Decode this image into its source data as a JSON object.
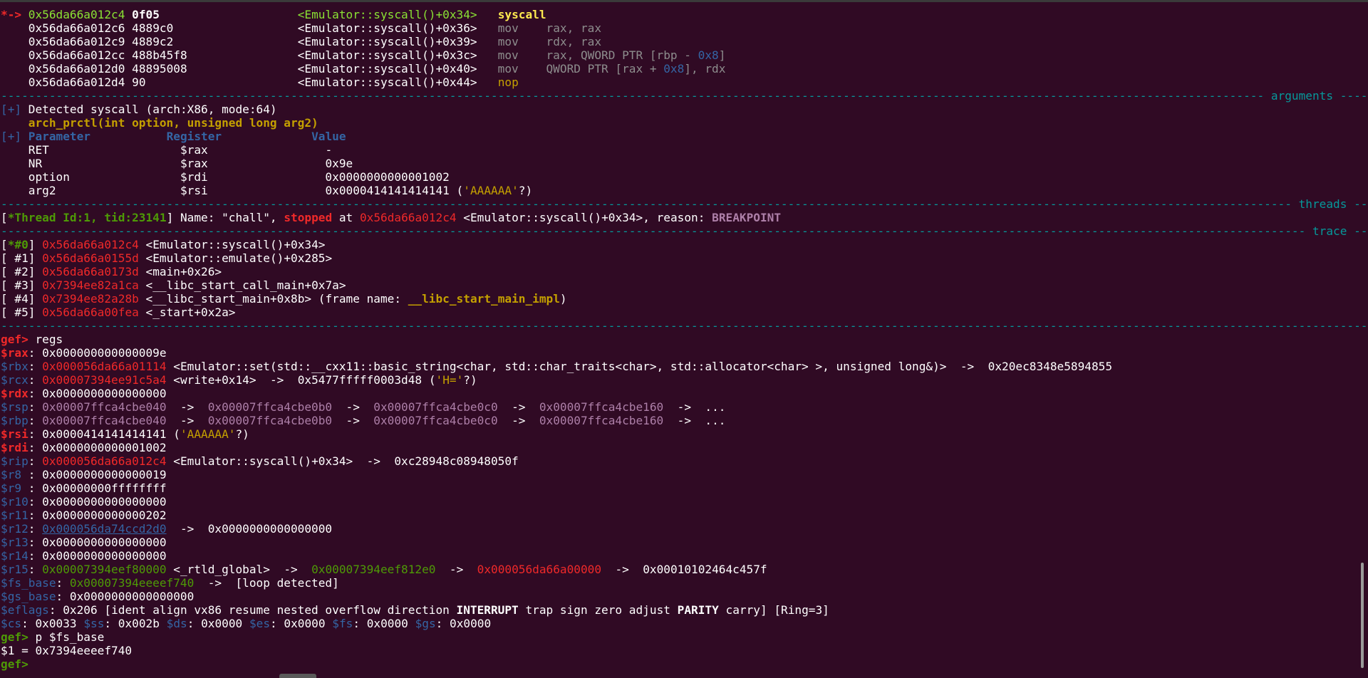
{
  "code": [
    {
      "marker": "*->",
      "addr": "0x56da66a012c4",
      "bytes": "0f05",
      "sym": "<Emulator::syscall()+0x34>",
      "op": "syscall",
      "args": ""
    },
    {
      "marker": "",
      "addr": "0x56da66a012c6",
      "bytes": "4889c0",
      "sym": "<Emulator::syscall()+0x36>",
      "op": "mov",
      "args": "rax, rax"
    },
    {
      "marker": "",
      "addr": "0x56da66a012c9",
      "bytes": "4889c2",
      "sym": "<Emulator::syscall()+0x39>",
      "op": "mov",
      "args": "rdx, rax"
    },
    {
      "marker": "",
      "addr": "0x56da66a012cc",
      "bytes": "488b45f8",
      "sym": "<Emulator::syscall()+0x3c>",
      "op": "mov",
      "args": "rax, QWORD PTR [rbp - 0x8]"
    },
    {
      "marker": "",
      "addr": "0x56da66a012d0",
      "bytes": "48895008",
      "sym": "<Emulator::syscall()+0x40>",
      "op": "mov",
      "args": "QWORD PTR [rax + 0x8], rdx"
    },
    {
      "marker": "",
      "addr": "0x56da66a012d4",
      "bytes": "90",
      "sym": "<Emulator::syscall()+0x44>",
      "op": "nop",
      "args": ""
    }
  ],
  "sections": {
    "arguments": "arguments",
    "threads": "threads",
    "trace": "trace"
  },
  "arguments": {
    "prefix": "[+]",
    "detected": "Detected syscall (arch:X86, mode:64)",
    "signature": "arch_prctl(int option, unsigned long arg2)",
    "headers": [
      "Parameter",
      "Register",
      "Value"
    ],
    "rows": [
      {
        "param": "RET",
        "reg": "$rax",
        "value": "-",
        "extra": ""
      },
      {
        "param": "NR",
        "reg": "$rax",
        "value": "0x9e",
        "extra": ""
      },
      {
        "param": "option",
        "reg": "$rdi",
        "value": "0x0000000000001002",
        "extra": ""
      },
      {
        "param": "arg2",
        "reg": "$rsi",
        "value": "0x0000414141414141",
        "extra": "'AAAAAA'"
      }
    ]
  },
  "thread": {
    "id": "*Thread Id:1, tid:23141",
    "name": "Name: \"chall\",",
    "state": "stopped",
    "at": "at",
    "addr": "0x56da66a012c4",
    "sym": "<Emulator::syscall()+0x34>, reason:",
    "reason": "BREAKPOINT"
  },
  "trace": [
    {
      "idx": "*#0",
      "addr": "0x56da66a012c4",
      "sym": "<Emulator::syscall()+0x34>",
      "frame": ""
    },
    {
      "idx": " #1",
      "addr": "0x56da66a0155d",
      "sym": "<Emulator::emulate()+0x285>",
      "frame": ""
    },
    {
      "idx": " #2",
      "addr": "0x56da66a0173d",
      "sym": "<main+0x26>",
      "frame": ""
    },
    {
      "idx": " #3",
      "addr": "0x7394ee82a1ca",
      "sym": "<__libc_start_call_main+0x7a>",
      "frame": ""
    },
    {
      "idx": " #4",
      "addr": "0x7394ee82a28b",
      "sym": "<__libc_start_main+0x8b>",
      "frame": "__libc_start_main_impl"
    },
    {
      "idx": " #5",
      "addr": "0x56da66a00fea",
      "sym": "<_start+0x2a>",
      "frame": ""
    }
  ],
  "prompt": "gef>",
  "cmd1": "regs",
  "regs": {
    "rax": "0x000000000000009e",
    "rbx_val": "0x000056da66a01114",
    "rbx_sym": "<Emulator::set(std::__cxx11::basic_string<char, std::char_traits<char>, std::allocator<char> >, unsigned long&)>",
    "rbx_deref": "0x20ec8348e5894855",
    "rcx_val": "0x00007394ee91c5a4",
    "rcx_sym": "<write+0x14>",
    "rcx_deref": "0x5477fffff0003d48",
    "rcx_str": "'H='",
    "rdx": "0x0000000000000000",
    "rsp_chain": [
      "0x00007ffca4cbe040",
      "0x00007ffca4cbe0b0",
      "0x00007ffca4cbe0c0",
      "0x00007ffca4cbe160"
    ],
    "rbp_chain": [
      "0x00007ffca4cbe040",
      "0x00007ffca4cbe0b0",
      "0x00007ffca4cbe0c0",
      "0x00007ffca4cbe160"
    ],
    "rsi": "0x0000414141414141",
    "rsi_str": "'AAAAAA'",
    "rdi": "0x0000000000001002",
    "rip_val": "0x000056da66a012c4",
    "rip_sym": "<Emulator::syscall()+0x34>",
    "rip_deref": "0xc28948c08948050f",
    "r8": "0x0000000000000019",
    "r9": "0x00000000ffffffff",
    "r10": "0x0000000000000000",
    "r11": "0x0000000000000202",
    "r12_val": "0x000056da74ccd2d0",
    "r12_deref": "0x0000000000000000",
    "r13": "0x0000000000000000",
    "r14": "0x0000000000000000",
    "r15_val": "0x00007394eef80000",
    "r15_sym": "<_rtld_global>",
    "r15_d1": "0x00007394eef812e0",
    "r15_d2": "0x000056da66a00000",
    "r15_d3": "0x00010102464c457f",
    "fs_base": "0x00007394eeeef740",
    "fs_note": "[loop detected]",
    "gs_base": "0x0000000000000000",
    "eflags": "0x206",
    "flags_pre": "[ident align vx86 resume nested overflow direction",
    "flag_int": "INTERRUPT",
    "flags_mid": "trap sign zero adjust",
    "flag_par": "PARITY",
    "flags_post": "carry] [Ring=3]",
    "cs": "0x0033",
    "ss": "0x002b",
    "ds": "0x0000",
    "es": "0x0000",
    "fs": "0x0000",
    "gs": "0x0000"
  },
  "cmd2": "p $fs_base",
  "result": "$1 = 0x7394eeeef740"
}
